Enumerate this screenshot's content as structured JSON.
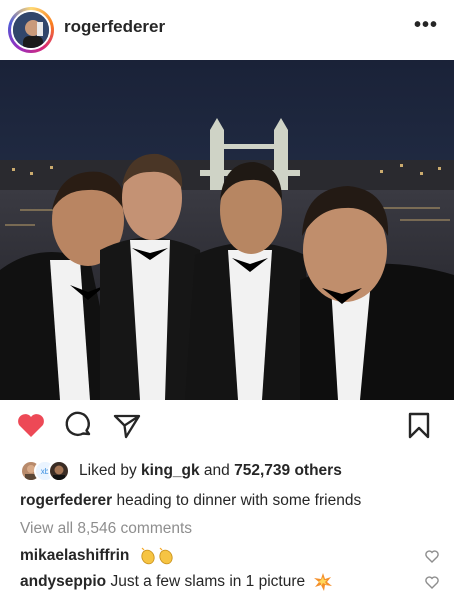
{
  "post": {
    "username": "rogerfederer",
    "more_icon": "more-options-icon",
    "more_glyph": "•••"
  },
  "actions": {
    "like_icon": "heart-filled-icon",
    "comment_icon": "comment-icon",
    "share_icon": "paper-plane-icon",
    "save_icon": "bookmark-icon",
    "like_color": "#ed4956"
  },
  "likes": {
    "prefix": "Liked by ",
    "user": "king_gk",
    "middle": " and ",
    "count": "752,739 others",
    "mini_avatar_badge": "xb"
  },
  "caption": {
    "user": "rogerfederer",
    "text": " heading to dinner with some friends"
  },
  "view_all": "View all 8,546 comments",
  "comments": [
    {
      "user": "mikaelashiffrin",
      "text": "",
      "emoji": "clapping-hands-emoji"
    },
    {
      "user": "andyseppio",
      "text": " Just a few slams in 1 picture",
      "emoji": "collision-emoji"
    }
  ]
}
